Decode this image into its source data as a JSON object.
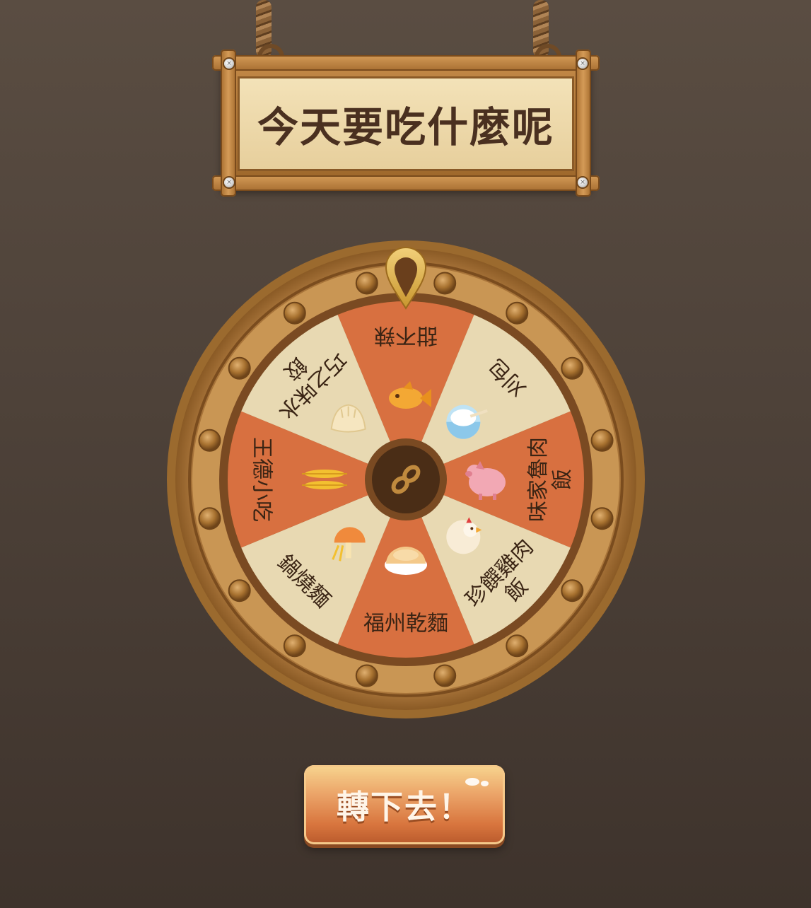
{
  "title": "今天要吃什麼呢",
  "wheel": {
    "segments": [
      {
        "label": "甜不辣",
        "icon": "fish-icon",
        "color": "#d87040"
      },
      {
        "label": "刈包",
        "icon": "rice-bowl-icon",
        "color": "#e8d9b2"
      },
      {
        "label": "味家魯肉飯",
        "icon": "pig-icon",
        "color": "#d87040"
      },
      {
        "label": "珍饌雞肉飯",
        "icon": "chicken-icon",
        "color": "#e8d9b2"
      },
      {
        "label": "福州乾麵",
        "icon": "bun-icon",
        "color": "#d87040"
      },
      {
        "label": "鍋燒麵",
        "icon": "mushroom-icon",
        "color": "#e8d9b2"
      },
      {
        "label": "王德小吃",
        "icon": "wheat-icon",
        "color": "#d87040"
      },
      {
        "label": "巧之味水餃",
        "icon": "dumpling-icon",
        "color": "#e8d9b2"
      }
    ],
    "center_icon": "infinity-icon"
  },
  "spin_button_label": "轉下去！",
  "colors": {
    "accent_orange": "#d87040",
    "cream": "#e8d9b2",
    "wood": "#b8803e",
    "dark_brown": "#4a3020"
  }
}
